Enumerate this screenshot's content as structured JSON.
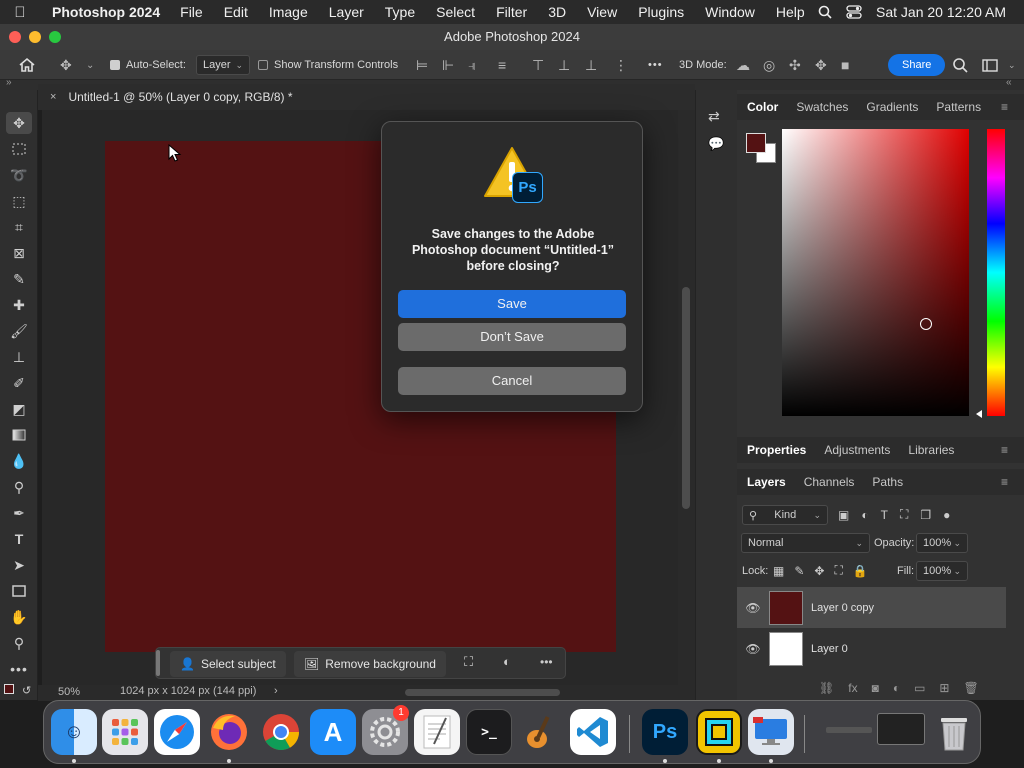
{
  "menubar": {
    "app_name": "Photoshop 2024",
    "items": [
      "File",
      "Edit",
      "Image",
      "Layer",
      "Type",
      "Select",
      "Filter",
      "3D",
      "View",
      "Plugins",
      "Window",
      "Help"
    ],
    "datetime": "Sat Jan 20  12:20 AM"
  },
  "window": {
    "title": "Adobe Photoshop 2024"
  },
  "options_bar": {
    "auto_select_label": "Auto-Select:",
    "auto_select_value": "Layer",
    "show_transform_label": "Show Transform Controls",
    "mode_3d_label": "3D Mode:",
    "share_label": "Share",
    "more_glyph": "•••"
  },
  "document": {
    "tab_close": "×",
    "tab_title": "Untitled-1 @ 50% (Layer 0 copy, RGB/8) *",
    "zoom": "50%",
    "info": "1024 px x 1024 px (144 ppi)",
    "info_arrow": "›",
    "canvas_color": "#541213"
  },
  "taskbar": {
    "select_subject": "Select subject",
    "remove_background": "Remove background",
    "more": "•••"
  },
  "color_panel": {
    "tabs": [
      "Color",
      "Swatches",
      "Gradients",
      "Patterns"
    ],
    "foreground": "#541213",
    "background": "#ffffff"
  },
  "properties_panel": {
    "tabs": [
      "Properties",
      "Adjustments",
      "Libraries"
    ]
  },
  "layers_panel": {
    "tabs": [
      "Layers",
      "Channels",
      "Paths"
    ],
    "filter_label": "Kind",
    "blend_mode": "Normal",
    "opacity_label": "Opacity:",
    "opacity_value": "100%",
    "lock_label": "Lock:",
    "fill_label": "Fill:",
    "fill_value": "100%",
    "layers": [
      {
        "name": "Layer 0 copy",
        "selected": true
      },
      {
        "name": "Layer 0",
        "selected": false
      }
    ]
  },
  "dialog": {
    "badge": "Ps",
    "message": "Save changes to the Adobe Photoshop document “Untitled-1” before closing?",
    "save": "Save",
    "dont_save": "Don’t Save",
    "cancel": "Cancel"
  },
  "dock": {
    "items": [
      "finder-icon",
      "launchpad-icon",
      "safari-icon",
      "firefox-icon",
      "chrome-icon",
      "app-store-icon",
      "system-settings-icon",
      "textedit-icon",
      "terminal-icon",
      "garageband-icon",
      "vscode-icon",
      "photoshop-icon",
      "geometry-dash-icon",
      "remote-desktop-icon",
      "window-icon",
      "trash-icon"
    ],
    "photoshop_label": "Ps",
    "settings_badge": "1",
    "terminal_glyph": ">_"
  }
}
